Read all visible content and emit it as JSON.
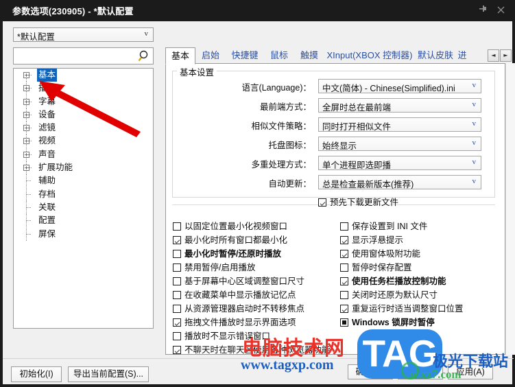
{
  "window": {
    "title": "参数选项(230905) - *默认配置",
    "pin_icon": "pin-icon",
    "close_icon": "close-icon"
  },
  "sidebar": {
    "config_dropdown": {
      "value": "*默认配置",
      "arrow": "v"
    },
    "search": {
      "value": "",
      "placeholder": ""
    },
    "tree": [
      {
        "label": "基本",
        "expandable": true,
        "selected": true
      },
      {
        "label": "播放",
        "expandable": true,
        "selected": false
      },
      {
        "label": "字幕",
        "expandable": true,
        "selected": false
      },
      {
        "label": "设备",
        "expandable": true,
        "selected": false
      },
      {
        "label": "滤镜",
        "expandable": true,
        "selected": false
      },
      {
        "label": "视频",
        "expandable": true,
        "selected": false
      },
      {
        "label": "声音",
        "expandable": true,
        "selected": false
      },
      {
        "label": "扩展功能",
        "expandable": true,
        "selected": false
      },
      {
        "label": "辅助",
        "expandable": false,
        "selected": false
      },
      {
        "label": "存档",
        "expandable": false,
        "selected": false
      },
      {
        "label": "关联",
        "expandable": false,
        "selected": false
      },
      {
        "label": "配置",
        "expandable": false,
        "selected": false
      },
      {
        "label": "屏保",
        "expandable": false,
        "selected": false
      }
    ],
    "buttons": {
      "init": "初始化(I)",
      "export": "导出当前配置(S)..."
    }
  },
  "tabs": [
    {
      "label": "基本",
      "active": true
    },
    {
      "label": "启始",
      "active": false
    },
    {
      "label": "快捷键",
      "active": false
    },
    {
      "label": "鼠标",
      "active": false
    },
    {
      "label": "触摸",
      "active": false
    },
    {
      "label": "XInput(XBOX 控制器)",
      "active": false
    },
    {
      "label": "默认皮肤",
      "active": false
    },
    {
      "label": "进",
      "active": false
    }
  ],
  "tab_scroll": {
    "left": "◄",
    "right": "►"
  },
  "groupbox": {
    "title": "基本设置",
    "fields": [
      {
        "label": "语言(Language)：",
        "value": "中文(简体) - Chinese(Simplified).ini"
      },
      {
        "label": "最前端方式：",
        "value": "全屏时总在最前端"
      },
      {
        "label": "相似文件策略：",
        "value": "同时打开相似文件"
      },
      {
        "label": "托盘图标：",
        "value": "始终显示"
      },
      {
        "label": "多重处理方式：",
        "value": "单个进程即选即播"
      },
      {
        "label": "自动更新：",
        "value": "总是检查最新版本(推荐)"
      }
    ],
    "prefetch_checkbox": {
      "label": "预先下载更新文件",
      "state": "checked",
      "bold": false
    }
  },
  "checkboxes_left": [
    {
      "label": "以固定位置最小化视频窗口",
      "state": "unchecked",
      "bold": false
    },
    {
      "label": "最小化时所有窗口都最小化",
      "state": "checked",
      "bold": false
    },
    {
      "label": "最小化时暂停/还原时播放",
      "state": "unchecked",
      "bold": true
    },
    {
      "label": "禁用暂停/启用播放",
      "state": "unchecked",
      "bold": false
    },
    {
      "label": "基于屏幕中心区域调整窗口尺寸",
      "state": "unchecked",
      "bold": false
    },
    {
      "label": "在收藏菜单中显示播放记忆点",
      "state": "unchecked",
      "bold": false
    },
    {
      "label": "从资源管理器启动时不转移焦点",
      "state": "unchecked",
      "bold": false
    },
    {
      "label": "拖拽文件播放时显示界面选项",
      "state": "checked",
      "bold": false
    },
    {
      "label": "播放时不显示错误窗口",
      "state": "unchecked",
      "bold": false
    },
    {
      "label": "不聊天时在聊天区使用各种浏览器功能",
      "state": "checked",
      "bold": false
    }
  ],
  "checkboxes_right": [
    {
      "label": "保存设置到 INI 文件",
      "state": "unchecked",
      "bold": false
    },
    {
      "label": "显示浮悬提示",
      "state": "checked",
      "bold": false
    },
    {
      "label": "使用窗体吸附功能",
      "state": "checked",
      "bold": false
    },
    {
      "label": "暂停时保存配置",
      "state": "unchecked",
      "bold": false
    },
    {
      "label": "使用任务栏播放控制功能",
      "state": "checked",
      "bold": true
    },
    {
      "label": "关闭时还原为默认尺寸",
      "state": "unchecked",
      "bold": false
    },
    {
      "label": "重复运行时适当调整窗口位置",
      "state": "checked",
      "bold": false
    },
    {
      "label": "Windows 锁屏时暂停",
      "state": "indeterminate",
      "bold": true
    }
  ],
  "dialog_buttons": {
    "ok": "确定(O)",
    "cancel": "取消(C)",
    "apply": "应用(A)"
  },
  "watermarks": {
    "site_cn": "电脑技术网",
    "site_url": "www.tagxp.com",
    "tag_logo": "TAG",
    "jiguang": "极光下载站",
    "xz_url": "w.xz7.com"
  },
  "colors": {
    "title_bg": "#1b1b1b",
    "selection": "#1063b8",
    "tab_text": "#2b4f9e",
    "annotation_arrow": "#e00000"
  }
}
